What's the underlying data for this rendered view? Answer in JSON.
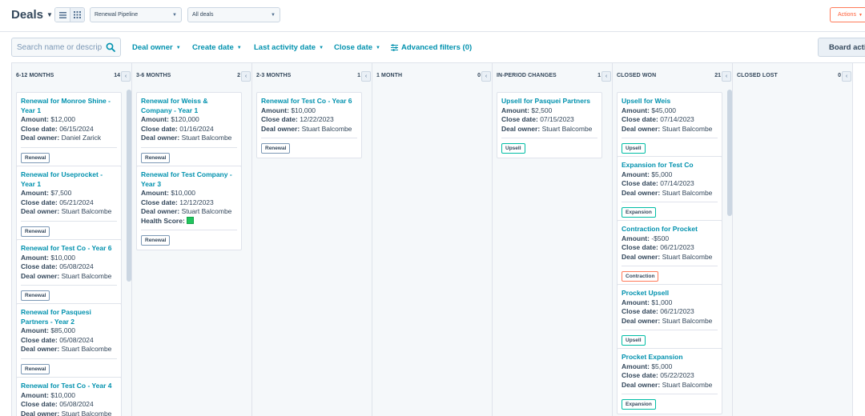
{
  "header": {
    "title": "Deals",
    "pipeline_select": "Renewal Pipeline",
    "deals_select": "All deals",
    "actions_label": "Actions"
  },
  "filters": {
    "search_placeholder": "Search name or description",
    "deal_owner": "Deal owner",
    "create_date": "Create date",
    "last_activity_date": "Last activity date",
    "close_date": "Close date",
    "advanced_filters": "Advanced filters (0)",
    "board_actions": "Board actions"
  },
  "labels": {
    "amount": "Amount:",
    "close_date": "Close date:",
    "deal_owner": "Deal owner:",
    "health_score": "Health Score:"
  },
  "columns": [
    {
      "title": "6-12 MONTHS",
      "count": "14",
      "cards": [
        {
          "title": "Renewal for Monroe Shine - Year 1",
          "amount": "$12,000",
          "close_date": "06/15/2024",
          "owner": "Daniel Zarick",
          "tag": "Renewal"
        },
        {
          "title": "Renewal for Useprocket - Year 1",
          "amount": "$7,500",
          "close_date": "05/21/2024",
          "owner": "Stuart Balcombe",
          "tag": "Renewal"
        },
        {
          "title": "Renewal for Test Co - Year 6",
          "amount": "$10,000",
          "close_date": "05/08/2024",
          "owner": "Stuart Balcombe",
          "tag": "Renewal"
        },
        {
          "title": "Renewal for Pasquesi Partners - Year 2",
          "amount": "$85,000",
          "close_date": "05/08/2024",
          "owner": "Stuart Balcombe",
          "tag": "Renewal"
        },
        {
          "title": "Renewal for Test Co - Year 4",
          "amount": "$10,000",
          "close_date": "05/08/2024",
          "owner": "Stuart Balcombe",
          "tag": ""
        }
      ]
    },
    {
      "title": "3-6 MONTHS",
      "count": "2",
      "cards": [
        {
          "title": "Renewal for Weiss & Company - Year 1",
          "amount": "$120,000",
          "close_date": "01/16/2024",
          "owner": "Stuart Balcombe",
          "tag": "Renewal"
        },
        {
          "title": "Renewal for Test Company - Year 3",
          "amount": "$10,000",
          "close_date": "12/12/2023",
          "owner": "Stuart Balcombe",
          "tag": "Renewal",
          "health_color": "#22c55e"
        }
      ]
    },
    {
      "title": "2-3 MONTHS",
      "count": "1",
      "cards": [
        {
          "title": "Renewal for Test Co - Year 6",
          "amount": "$10,000",
          "close_date": "12/22/2023",
          "owner": "Stuart Balcombe",
          "tag": "Renewal"
        }
      ]
    },
    {
      "title": "1 MONTH",
      "count": "0",
      "cards": []
    },
    {
      "title": "IN-PERIOD CHANGES",
      "count": "1",
      "cards": [
        {
          "title": "Upsell for Pasquei Partners",
          "amount": "$2,500",
          "close_date": "07/15/2023",
          "owner": "Stuart Balcombe",
          "tag": "Upsell"
        }
      ]
    },
    {
      "title": "CLOSED WON",
      "count": "21",
      "cards": [
        {
          "title": "Upsell for Weis",
          "amount": "$45,000",
          "close_date": "07/14/2023",
          "owner": "Stuart Balcombe",
          "tag": "Upsell"
        },
        {
          "title": "Expansion for Test Co",
          "amount": "$5,000",
          "close_date": "07/14/2023",
          "owner": "Stuart Balcombe",
          "tag": "Expansion"
        },
        {
          "title": "Contraction for Procket",
          "amount": "-$500",
          "close_date": "06/21/2023",
          "owner": "Stuart Balcombe",
          "tag": "Contraction"
        },
        {
          "title": "Procket Upsell",
          "amount": "$1,000",
          "close_date": "06/21/2023",
          "owner": "Stuart Balcombe",
          "tag": "Upsell"
        },
        {
          "title": "Procket Expansion",
          "amount": "$5,000",
          "close_date": "05/22/2023",
          "owner": "Stuart Balcombe",
          "tag": "Expansion"
        }
      ]
    },
    {
      "title": "CLOSED LOST",
      "count": "0",
      "cards": []
    }
  ]
}
